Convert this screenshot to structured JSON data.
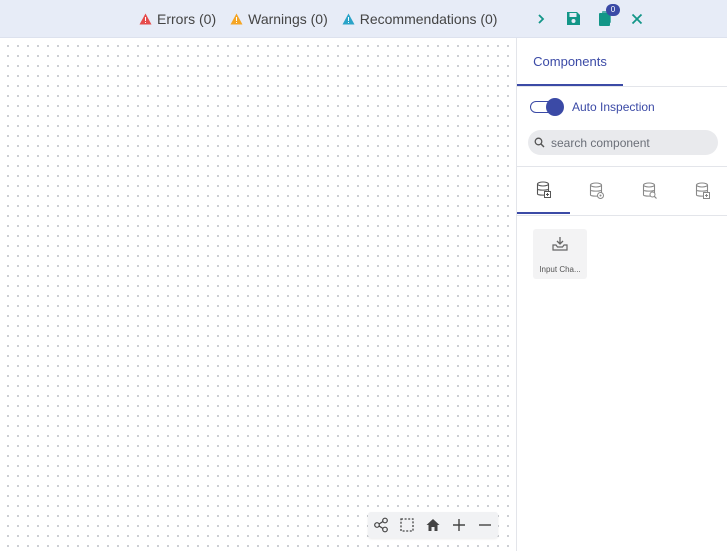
{
  "topbar": {
    "errors": "Errors (0)",
    "warnings": "Warnings (0)",
    "recommendations": "Recommendations (0)",
    "clipboard_badge": "0",
    "colors": {
      "error": "#e64b4b",
      "warning": "#f5a524",
      "recommendation": "#2aa3c8",
      "action": "#139688"
    }
  },
  "panel": {
    "tab_label": "Components",
    "auto_inspection_label": "Auto Inspection",
    "auto_inspection_on": true,
    "search_placeholder": "search component",
    "category_icons": [
      "database-add-icon",
      "database-gear-icon",
      "database-search-icon",
      "database-plus-icon"
    ],
    "components": [
      {
        "label": "Input Cha...",
        "icon": "input-channel-icon"
      }
    ]
  },
  "canvas_tools": [
    "connect-nodes-icon",
    "select-area-icon",
    "home-icon",
    "zoom-in-icon",
    "zoom-out-icon"
  ],
  "accent": "#3b4aa6"
}
